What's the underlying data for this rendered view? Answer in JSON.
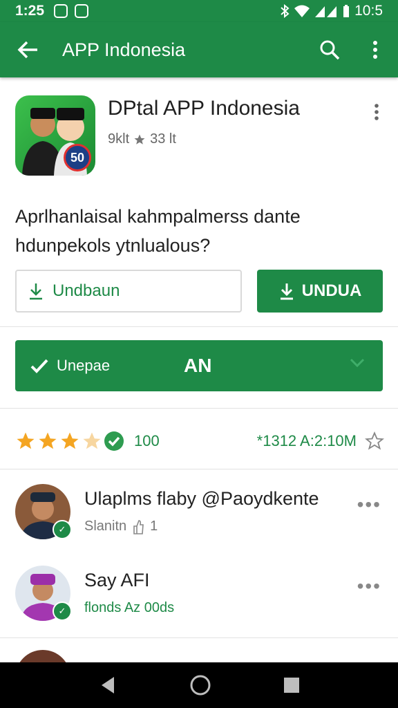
{
  "status_bar": {
    "time": "1:25",
    "right_text": "10:5"
  },
  "app_bar": {
    "title": "APP Indonesia"
  },
  "app": {
    "name": "DPtal APP Indonesia",
    "sub_left": "9klt",
    "sub_right": "33 lt",
    "icon_badge": "50"
  },
  "description": {
    "line1": "Aprlhanlaisal kahmpalmerss dante",
    "line2": "hdunpekols ytnlualous?"
  },
  "buttons": {
    "outline_label": "Undbaun",
    "filled_label": "UNDUA",
    "wide_label": "Unepae",
    "wide_center": "AN"
  },
  "rating": {
    "stars_filled": 3,
    "stars_half": 1,
    "count": "100",
    "time": "*1312 A:2:10M"
  },
  "reviews": [
    {
      "name": "Ulaplms flaby @Paoydkente",
      "meta": "Slanitn",
      "meta_count": "1"
    },
    {
      "name": "Say AFI",
      "meta": "flonds Az 00ds"
    }
  ],
  "colors": {
    "primary": "#1e8a47",
    "star": "#f4a522"
  }
}
